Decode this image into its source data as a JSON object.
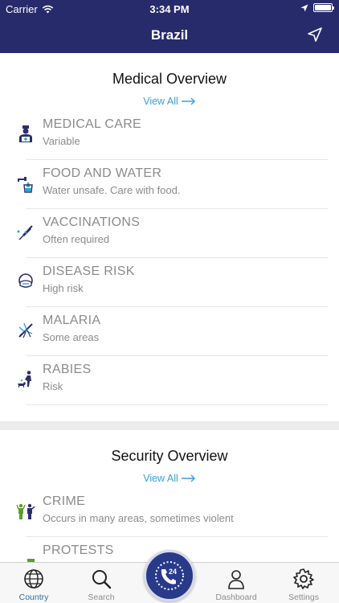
{
  "status": {
    "carrier": "Carrier",
    "time": "3:34 PM"
  },
  "nav": {
    "title": "Brazil"
  },
  "medical": {
    "title": "Medical Overview",
    "view_all": "View All",
    "items": [
      {
        "title": "MEDICAL CARE",
        "subtitle": "Variable",
        "icon": "medical-care-icon"
      },
      {
        "title": "FOOD AND WATER",
        "subtitle": "Water unsafe. Care with food.",
        "icon": "food-water-icon"
      },
      {
        "title": "VACCINATIONS",
        "subtitle": "Often required",
        "icon": "vaccination-icon"
      },
      {
        "title": "DISEASE RISK",
        "subtitle": "High risk",
        "icon": "disease-risk-icon"
      },
      {
        "title": "MALARIA",
        "subtitle": "Some areas",
        "icon": "mosquito-icon"
      },
      {
        "title": "RABIES",
        "subtitle": "Risk",
        "icon": "rabies-icon"
      }
    ]
  },
  "security": {
    "title": "Security Overview",
    "view_all": "View All",
    "items": [
      {
        "title": "CRIME",
        "subtitle": "Occurs in many areas, sometimes violent",
        "icon": "crime-icon"
      },
      {
        "title": "PROTESTS",
        "subtitle": "",
        "icon": "protests-icon"
      }
    ]
  },
  "tabs": [
    {
      "label": "Country",
      "icon": "globe-icon",
      "active": true
    },
    {
      "label": "Search",
      "icon": "search-icon",
      "active": false
    },
    {
      "label": "",
      "icon": "emergency-24-phone-icon",
      "active": false
    },
    {
      "label": "Dashboard",
      "icon": "person-icon",
      "active": false
    },
    {
      "label": "Settings",
      "icon": "gear-icon",
      "active": false
    }
  ],
  "colors": {
    "nav": "#272a6b",
    "accent_link": "#3aa0d8",
    "active_tab": "#2c6ea5",
    "security_icon": "#5a9e2e"
  }
}
